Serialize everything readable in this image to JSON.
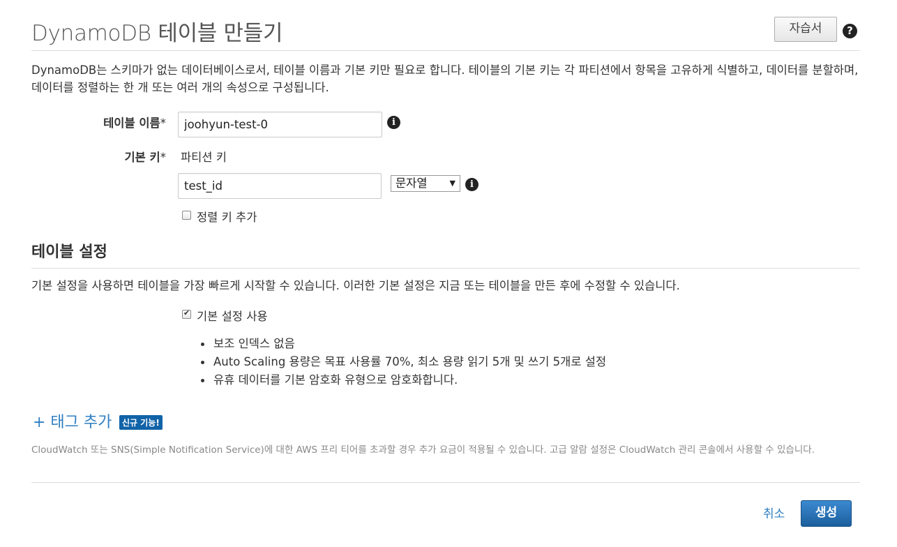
{
  "header": {
    "title": "DynamoDB 테이블 만들기",
    "tutorial_label": "자습서",
    "help_icon": "question-circle-icon",
    "help_glyph": "?"
  },
  "intro": "DynamoDB는 스키마가 없는 데이터베이스로서, 테이블 이름과 기본 키만 필요로 합니다. 테이블의 기본 키는 각 파티션에서 항목을 고유하게 식별하고, 데이터를 분할하며, 데이터를 정렬하는 한 개 또는 여러 개의 속성으로 구성됩니다.",
  "form": {
    "table_name_label": "테이블 이름",
    "primary_key_label": "기본 키",
    "required_mark": "*",
    "table_name_value": "joohyun-test-0",
    "partition_key_label": "파티션 키",
    "partition_key_value": "test_id",
    "partition_key_type": "문자열",
    "select_arrow": "▼",
    "info_glyph": "i",
    "add_sort_key_label": "정렬 키 추가",
    "add_sort_key_checked": false
  },
  "settings": {
    "title": "테이블 설정",
    "description": "기본 설정을 사용하면 테이블을 가장 빠르게 시작할 수 있습니다. 이러한 기본 설정은 지금 또는 테이블을 만든 후에 수정할 수 있습니다.",
    "use_defaults_label": "기본 설정 사용",
    "use_defaults_checked": true,
    "defaults": [
      "보조 인덱스 없음",
      "Auto Scaling 용량은 목표 사용률 70%, 최소 용량 읽기 5개 및 쓰기 5개로 설정",
      "유휴 데이터를 기본 암호화 유형으로 암호화합니다."
    ]
  },
  "tags": {
    "add_tag_label": "+ 태그 추가",
    "new_badge": "신규 기능!"
  },
  "cloudwatch_note": "CloudWatch 또는 SNS(Simple Notification Service)에 대한 AWS 프리 티어를 초과할 경우 추가 요금이 적용될 수 있습니다. 고급 알람 설정은 CloudWatch 관리 콘솔에서 사용할 수 있습니다.",
  "actions": {
    "cancel_label": "취소",
    "create_label": "생성"
  },
  "colors": {
    "link": "#2f7fc1",
    "primary_button": "#1b5f9d",
    "badge": "#1163a8"
  }
}
